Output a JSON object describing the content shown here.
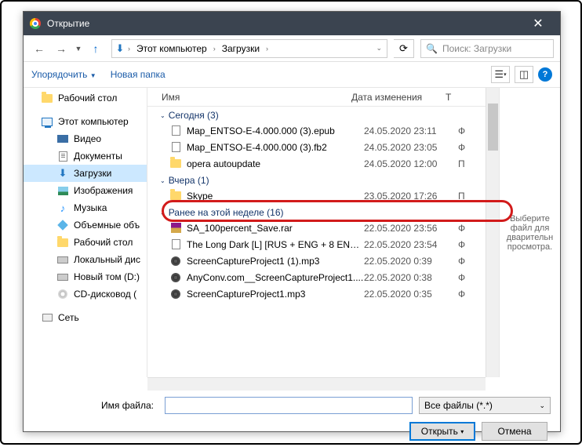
{
  "titlebar": {
    "title": "Открытие"
  },
  "breadcrumb": {
    "seg1": "Этот компьютер",
    "seg2": "Загрузки"
  },
  "search": {
    "placeholder": "Поиск: Загрузки"
  },
  "toolbar": {
    "organize": "Упорядочить",
    "newfolder": "Новая папка"
  },
  "columns": {
    "name": "Имя",
    "date": "Дата изменения",
    "type": "Т"
  },
  "sidebar": {
    "items": [
      {
        "label": "Рабочий стол",
        "icon": "folder"
      },
      {
        "label": "Этот компьютер",
        "icon": "pc",
        "gap": true
      },
      {
        "label": "Видео",
        "icon": "tv",
        "l2": true
      },
      {
        "label": "Документы",
        "icon": "doc",
        "l2": true
      },
      {
        "label": "Загрузки",
        "icon": "dl",
        "l2": true,
        "sel": true
      },
      {
        "label": "Изображения",
        "icon": "img",
        "l2": true
      },
      {
        "label": "Музыка",
        "icon": "note",
        "l2": true
      },
      {
        "label": "Объемные объ",
        "icon": "cube",
        "l2": true
      },
      {
        "label": "Рабочий стол",
        "icon": "folder",
        "l2": true
      },
      {
        "label": "Локальный дис",
        "icon": "hdd",
        "l2": true
      },
      {
        "label": "Новый том (D:)",
        "icon": "hdd",
        "l2": true
      },
      {
        "label": "CD-дисковод (",
        "icon": "disc",
        "l2": true
      },
      {
        "label": "Сеть",
        "icon": "net",
        "gap": true
      }
    ]
  },
  "groups": [
    {
      "title": "Сегодня (3)",
      "files": [
        {
          "name": "Map_ENTSO-E-4.000.000 (3).epub",
          "date": "24.05.2020 23:11",
          "t": "Ф",
          "icon": "page"
        },
        {
          "name": "Map_ENTSO-E-4.000.000 (3).fb2",
          "date": "24.05.2020 23:05",
          "t": "Ф",
          "icon": "page"
        },
        {
          "name": "opera autoupdate",
          "date": "24.05.2020 12:00",
          "t": "П",
          "icon": "folder"
        }
      ]
    },
    {
      "title": "Вчера (1)",
      "files": [
        {
          "name": "Skype",
          "date": "23.05.2020 17:26",
          "t": "П",
          "icon": "folder"
        }
      ]
    },
    {
      "title": "Ранее на этой неделе (16)",
      "files": [
        {
          "name": "SA_100percent_Save.rar",
          "date": "22.05.2020 23:56",
          "t": "Ф",
          "icon": "rar"
        },
        {
          "name": "The Long Dark [L] [RUS + ENG + 8 ENG] (...",
          "date": "22.05.2020 23:54",
          "t": "Ф",
          "icon": "page"
        },
        {
          "name": "ScreenCaptureProject1 (1).mp3",
          "date": "22.05.2020 0:39",
          "t": "Ф",
          "icon": "mp3"
        },
        {
          "name": "AnyConv.com__ScreenCaptureProject1....",
          "date": "22.05.2020 0:38",
          "t": "Ф",
          "icon": "mp3"
        },
        {
          "name": "ScreenCaptureProject1.mp3",
          "date": "22.05.2020 0:35",
          "t": "Ф",
          "icon": "mp3"
        }
      ]
    }
  ],
  "preview": {
    "text": "Выберите файл для дварительн просмотра."
  },
  "filename": {
    "label": "Имя файла:",
    "value": ""
  },
  "filetype": {
    "label": "Все файлы (*.*)"
  },
  "buttons": {
    "open": "Открыть",
    "cancel": "Отмена"
  }
}
